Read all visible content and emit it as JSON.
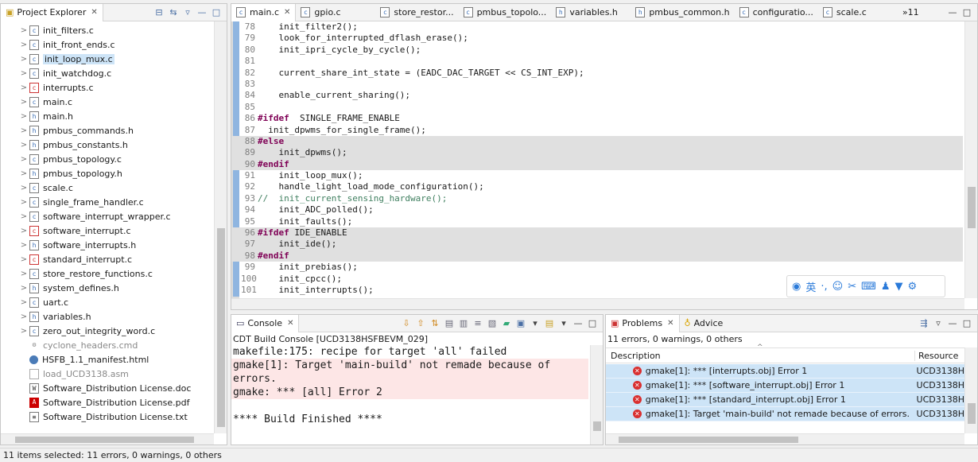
{
  "project_explorer": {
    "title": "Project Explorer",
    "items": [
      {
        "name": "init_filters.c",
        "kind": "c",
        "arrow": ">",
        "dim": false,
        "selected": false
      },
      {
        "name": "init_front_ends.c",
        "kind": "c",
        "arrow": ">",
        "dim": false,
        "selected": false
      },
      {
        "name": "init_loop_mux.c",
        "kind": "c",
        "arrow": ">",
        "dim": false,
        "selected": true
      },
      {
        "name": "init_watchdog.c",
        "kind": "c",
        "arrow": ">",
        "dim": false,
        "selected": false
      },
      {
        "name": "interrupts.c",
        "kind": "err",
        "arrow": ">",
        "dim": false,
        "selected": false
      },
      {
        "name": "main.c",
        "kind": "c",
        "arrow": ">",
        "dim": false,
        "selected": false
      },
      {
        "name": "main.h",
        "kind": "h",
        "arrow": ">",
        "dim": false,
        "selected": false
      },
      {
        "name": "pmbus_commands.h",
        "kind": "h",
        "arrow": ">",
        "dim": false,
        "selected": false
      },
      {
        "name": "pmbus_constants.h",
        "kind": "h",
        "arrow": ">",
        "dim": false,
        "selected": false
      },
      {
        "name": "pmbus_topology.c",
        "kind": "c",
        "arrow": ">",
        "dim": false,
        "selected": false
      },
      {
        "name": "pmbus_topology.h",
        "kind": "h",
        "arrow": ">",
        "dim": false,
        "selected": false
      },
      {
        "name": "scale.c",
        "kind": "c",
        "arrow": ">",
        "dim": false,
        "selected": false
      },
      {
        "name": "single_frame_handler.c",
        "kind": "c",
        "arrow": ">",
        "dim": false,
        "selected": false
      },
      {
        "name": "software_interrupt_wrapper.c",
        "kind": "c",
        "arrow": ">",
        "dim": false,
        "selected": false
      },
      {
        "name": "software_interrupt.c",
        "kind": "err",
        "arrow": ">",
        "dim": false,
        "selected": false
      },
      {
        "name": "software_interrupts.h",
        "kind": "h",
        "arrow": ">",
        "dim": false,
        "selected": false
      },
      {
        "name": "standard_interrupt.c",
        "kind": "err",
        "arrow": ">",
        "dim": false,
        "selected": false
      },
      {
        "name": "store_restore_functions.c",
        "kind": "c",
        "arrow": ">",
        "dim": false,
        "selected": false
      },
      {
        "name": "system_defines.h",
        "kind": "h",
        "arrow": ">",
        "dim": false,
        "selected": false
      },
      {
        "name": "uart.c",
        "kind": "c",
        "arrow": ">",
        "dim": false,
        "selected": false
      },
      {
        "name": "variables.h",
        "kind": "h",
        "arrow": ">",
        "dim": false,
        "selected": false
      },
      {
        "name": "zero_out_integrity_word.c",
        "kind": "c",
        "arrow": ">",
        "dim": false,
        "selected": false
      },
      {
        "name": "cyclone_headers.cmd",
        "kind": "cmd",
        "arrow": "",
        "dim": true,
        "selected": false
      },
      {
        "name": "HSFB_1.1_manifest.html",
        "kind": "html",
        "arrow": "",
        "dim": false,
        "selected": false
      },
      {
        "name": "load_UCD3138.asm",
        "kind": "asm",
        "arrow": "",
        "dim": true,
        "selected": false
      },
      {
        "name": "Software_Distribution License.doc",
        "kind": "doc",
        "arrow": "",
        "dim": false,
        "selected": false
      },
      {
        "name": "Software_Distribution License.pdf",
        "kind": "pdf",
        "arrow": "",
        "dim": false,
        "selected": false
      },
      {
        "name": "Software_Distribution License.txt",
        "kind": "txt",
        "arrow": "",
        "dim": false,
        "selected": false
      }
    ]
  },
  "editor": {
    "tabs": [
      "main.c",
      "gpio.c",
      "store_restor...",
      "pmbus_topolo...",
      "variables.h",
      "pmbus_common.h",
      "configuratio...",
      "scale.c"
    ],
    "overflow": "»11",
    "lines": [
      {
        "n": "78",
        "text": "    init_filter2();",
        "shade": false,
        "style": ""
      },
      {
        "n": "79",
        "text": "    look_for_interrupted_dflash_erase();",
        "shade": false,
        "style": ""
      },
      {
        "n": "80",
        "text": "    init_ipri_cycle_by_cycle();",
        "shade": false,
        "style": ""
      },
      {
        "n": "81",
        "text": "",
        "shade": false,
        "style": ""
      },
      {
        "n": "82",
        "text": "    current_share_int_state = (EADC_DAC_TARGET << CS_INT_EXP);",
        "shade": false,
        "style": ""
      },
      {
        "n": "83",
        "text": "",
        "shade": false,
        "style": ""
      },
      {
        "n": "84",
        "text": "    enable_current_sharing();",
        "shade": false,
        "style": ""
      },
      {
        "n": "85",
        "text": "",
        "shade": false,
        "style": ""
      },
      {
        "n": "86",
        "text": "#ifdef  SINGLE_FRAME_ENABLE",
        "shade": false,
        "style": "kw-first"
      },
      {
        "n": "87",
        "text": "  init_dpwms_for_single_frame();",
        "shade": false,
        "style": ""
      },
      {
        "n": "88",
        "text": "#else",
        "shade": true,
        "style": "kw-all"
      },
      {
        "n": "89",
        "text": "    init_dpwms();",
        "shade": true,
        "style": ""
      },
      {
        "n": "90",
        "text": "#endif",
        "shade": true,
        "style": "kw-all"
      },
      {
        "n": "91",
        "text": "    init_loop_mux();",
        "shade": false,
        "style": ""
      },
      {
        "n": "92",
        "text": "    handle_light_load_mode_configuration();",
        "shade": false,
        "style": ""
      },
      {
        "n": "93",
        "text": "//  init_current_sensing_hardware();",
        "shade": false,
        "style": "comment"
      },
      {
        "n": "94",
        "text": "    init_ADC_polled();",
        "shade": false,
        "style": ""
      },
      {
        "n": "95",
        "text": "    init_faults();",
        "shade": false,
        "style": ""
      },
      {
        "n": "96",
        "text": "#ifdef IDE_ENABLE",
        "shade": true,
        "style": "kw-first"
      },
      {
        "n": "97",
        "text": "    init_ide();",
        "shade": true,
        "style": ""
      },
      {
        "n": "98",
        "text": "#endif",
        "shade": true,
        "style": "kw-all"
      },
      {
        "n": "99",
        "text": "    init_prebias();",
        "shade": false,
        "style": ""
      },
      {
        "n": "100",
        "text": "    init_cpcc();",
        "shade": false,
        "style": ""
      },
      {
        "n": "101",
        "text": "    init_interrupts();",
        "shade": false,
        "style": ""
      }
    ],
    "ime_char": "英"
  },
  "console": {
    "tab": "Console",
    "header": "CDT Build Console [UCD3138HSFBEVM_029]",
    "lines": [
      {
        "text": "makefile:175: recipe for target 'all' failed",
        "error": false
      },
      {
        "text": "gmake[1]: Target 'main-build' not remade because of errors.",
        "error": true
      },
      {
        "text": "gmake: *** [all] Error 2",
        "error": true
      },
      {
        "text": "",
        "error": false
      },
      {
        "text": "**** Build Finished ****",
        "error": false
      }
    ]
  },
  "problems": {
    "tab": "Problems",
    "advice_tab": "Advice",
    "summary": "11 errors, 0 warnings, 0 others",
    "col_description": "Description",
    "col_resource": "Resource",
    "rows": [
      {
        "desc": "gmake[1]: *** [interrupts.obj] Error 1",
        "res": "UCD3138H"
      },
      {
        "desc": "gmake[1]: *** [software_interrupt.obj] Error 1",
        "res": "UCD3138H"
      },
      {
        "desc": "gmake[1]: *** [standard_interrupt.obj] Error 1",
        "res": "UCD3138H"
      },
      {
        "desc": "gmake[1]: Target 'main-build' not remade because of errors.",
        "res": "UCD3138H"
      }
    ]
  },
  "status_bar": {
    "text": "11 items selected: 11 errors, 0 warnings, 0 others"
  }
}
